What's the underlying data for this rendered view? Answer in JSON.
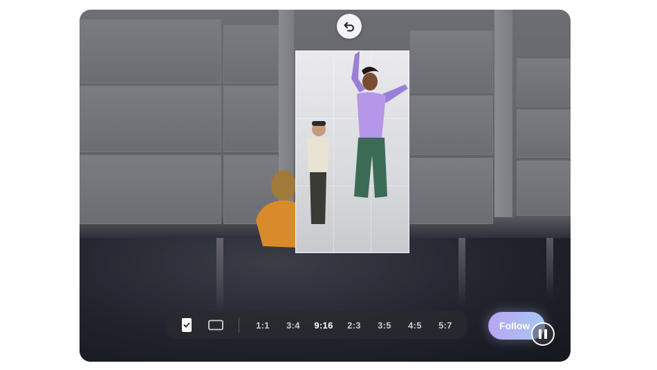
{
  "toolbar": {
    "icons": [
      "crop-portrait-check-icon",
      "crop-landscape-icon"
    ],
    "ratios": [
      {
        "label": "1:1",
        "active": false
      },
      {
        "label": "3:4",
        "active": false
      },
      {
        "label": "9:16",
        "active": true
      },
      {
        "label": "2:3",
        "active": false
      },
      {
        "label": "3:5",
        "active": false
      },
      {
        "label": "4:5",
        "active": false
      },
      {
        "label": "5:7",
        "active": false
      }
    ]
  },
  "follow_button": {
    "label": "Follow"
  },
  "undo_button": {
    "icon": "undo-icon"
  },
  "playback": {
    "icon": "pause-icon"
  },
  "colors": {
    "accent_gradient_start": "#b8a6f2",
    "accent_gradient_end": "#a7c7f4",
    "toolbar_bg": "#282a30"
  }
}
